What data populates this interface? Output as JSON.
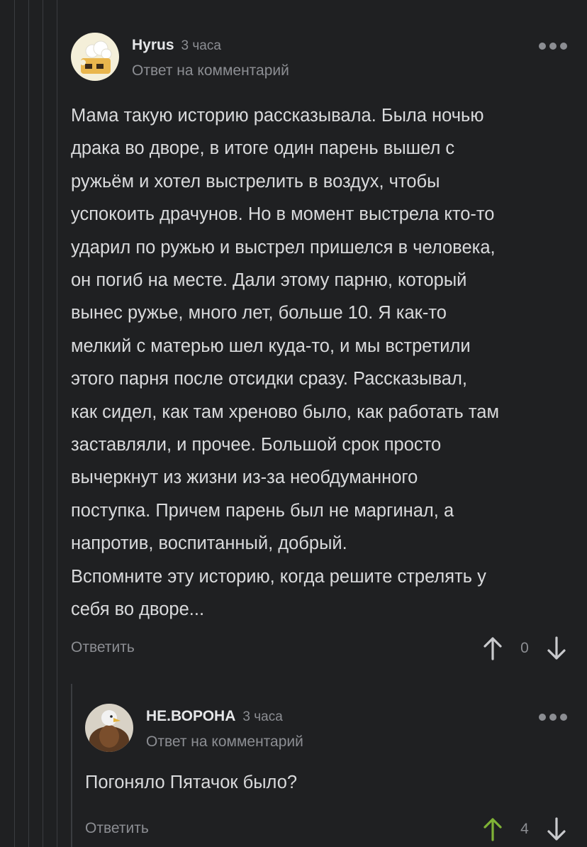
{
  "comments": [
    {
      "author": "Hyrus",
      "time": "3 часа",
      "reply_label": "Ответ на комментарий",
      "avatar_icon": "cartoon-face-avatar",
      "text": "Мама такую историю рассказывала. Была ночью\nдрака во дворе, в итоге один парень вышел с\nружьём и хотел выстрелить в воздух, чтобы\nуспокоить драчунов. Но в момент выстрела кто-то\nударил по ружью и выстрел пришелся в человека,\nон погиб на месте. Дали этому парню, который\nвынес ружье, много лет, больше 10. Я как-то\nмелкий с матерью шел куда-то, и мы встретили\nэтого парня после отсидки сразу. Рассказывал,\nкак сидел, как там хреново было, как работать там\nзаставляли, и прочее. Большой срок просто\nвычеркнут из жизни из-за необдуманного\nпоступка. Причем парень был не маргинал, а\nнапротив, воспитанный, добрый.\nВспомните эту историю, когда решите стрелять у\nсебя во дворе...",
      "reply_button": "Ответить",
      "score": "0",
      "upvote_color": "#c9cacd"
    },
    {
      "author": "НЕ.ВОРОНА",
      "time": "3 часа",
      "reply_label": "Ответ на комментарий",
      "avatar_icon": "eagle-avatar",
      "text": "Погоняло Пятачок было?",
      "reply_button": "Ответить",
      "score": "4",
      "upvote_color": "#7fb236"
    }
  ]
}
